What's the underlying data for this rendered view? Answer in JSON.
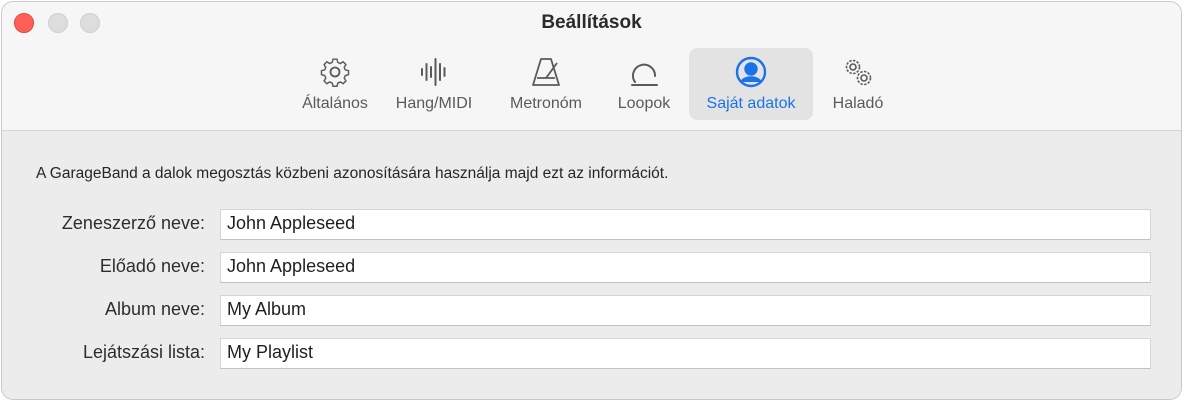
{
  "window": {
    "title": "Beállítások",
    "accent_color": "#1a73e8"
  },
  "toolbar": {
    "tabs": [
      {
        "label": "Általános",
        "icon": "gear-icon",
        "selected": false
      },
      {
        "label": "Hang/MIDI",
        "icon": "waveform-icon",
        "selected": false
      },
      {
        "label": "Metronóm",
        "icon": "metronome-icon",
        "selected": false
      },
      {
        "label": "Loopok",
        "icon": "loop-icon",
        "selected": false
      },
      {
        "label": "Saját adatok",
        "icon": "person-circle-icon",
        "selected": true
      },
      {
        "label": "Haladó",
        "icon": "gears-icon",
        "selected": false
      }
    ]
  },
  "main": {
    "info_text": "A GarageBand a dalok megosztás közbeni azonosítására használja majd ezt az információt.",
    "fields": [
      {
        "label": "Zeneszerző neve:",
        "value": "John Appleseed"
      },
      {
        "label": "Előadó neve:",
        "value": "John Appleseed"
      },
      {
        "label": "Album neve:",
        "value": "My Album"
      },
      {
        "label": "Lejátszási lista:",
        "value": "My Playlist"
      }
    ]
  }
}
